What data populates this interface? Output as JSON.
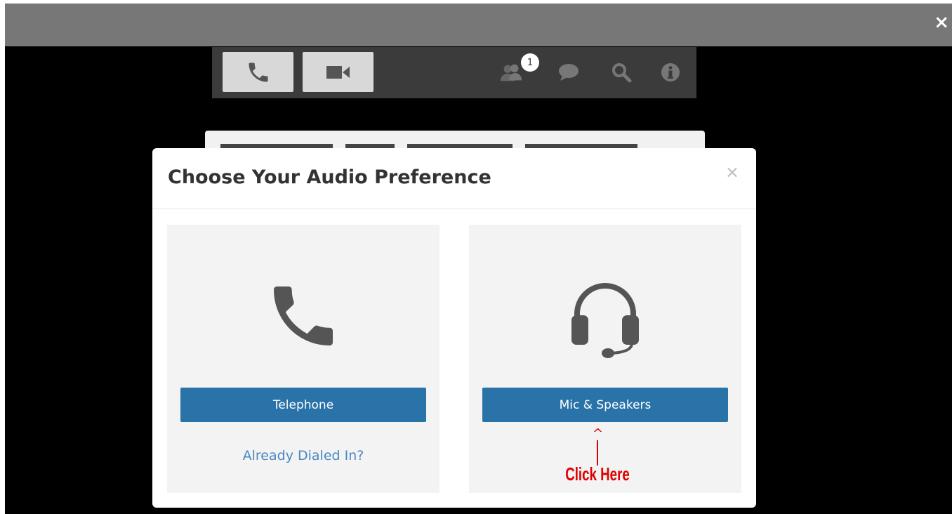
{
  "window": {
    "close_glyph": "×"
  },
  "toolbar": {
    "phone_icon": "phone-icon",
    "video_icon": "video-camera-icon",
    "participants_icon": "participants-icon",
    "participants_count": "1",
    "chat_icon": "chat-bubble-icon",
    "search_icon": "search-icon",
    "info_icon": "info-icon"
  },
  "modal": {
    "title": "Choose Your Audio Preference",
    "close_glyph": "×",
    "telephone_label": "Telephone",
    "dialed_in_link": "Already Dialed In?",
    "mic_label": "Mic & Speakers",
    "annotation_caret": "^",
    "annotation_text": "Click Here"
  },
  "colors": {
    "primary_button": "#2a73a8",
    "link": "#4a87c4",
    "annotation": "#e00000"
  }
}
